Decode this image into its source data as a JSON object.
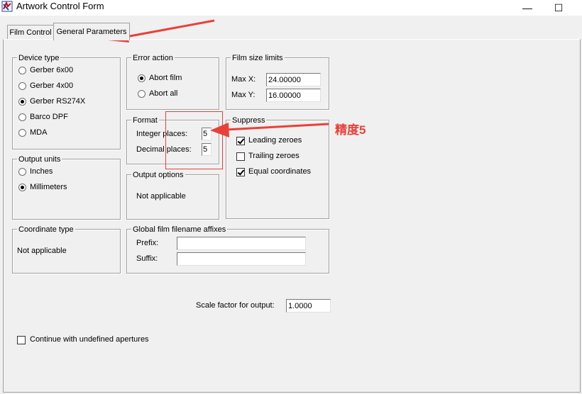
{
  "window": {
    "title": "Artwork Control Form",
    "minimize": "—",
    "maximize": "☐"
  },
  "tabs": [
    {
      "label": "Film Control",
      "active": false
    },
    {
      "label": "General Parameters",
      "active": true
    }
  ],
  "device_type": {
    "label": "Device type",
    "options": [
      {
        "label": "Gerber 6x00",
        "selected": false
      },
      {
        "label": "Gerber 4x00",
        "selected": false
      },
      {
        "label": "Gerber RS274X",
        "selected": true
      },
      {
        "label": "Barco DPF",
        "selected": false
      },
      {
        "label": "MDA",
        "selected": false
      }
    ]
  },
  "error_action": {
    "label": "Error action",
    "options": [
      {
        "label": "Abort film",
        "selected": true
      },
      {
        "label": "Abort all",
        "selected": false
      }
    ]
  },
  "film_size_limits": {
    "label": "Film size limits",
    "max_x_label": "Max X:",
    "max_x": "24.00000",
    "max_y_label": "Max Y:",
    "max_y": "16.00000"
  },
  "format": {
    "label": "Format",
    "integer_label": "Integer places:",
    "integer_value": "5",
    "decimal_label": "Decimal places:",
    "decimal_value": "5"
  },
  "suppress": {
    "label": "Suppress",
    "options": [
      {
        "label": "Leading zeroes",
        "checked": true
      },
      {
        "label": "Trailing zeroes",
        "checked": false
      },
      {
        "label": "Equal coordinates",
        "checked": true
      }
    ]
  },
  "output_units": {
    "label": "Output units",
    "options": [
      {
        "label": "Inches",
        "selected": false
      },
      {
        "label": "Millimeters",
        "selected": true
      }
    ]
  },
  "output_options": {
    "label": "Output options",
    "text": "Not applicable"
  },
  "coordinate_type": {
    "label": "Coordinate type",
    "text": "Not applicable"
  },
  "global_film": {
    "label": "Global film filename affixes",
    "prefix_label": "Prefix:",
    "prefix_value": "",
    "suffix_label": "Suffix:",
    "suffix_value": ""
  },
  "scale": {
    "label": "Scale factor for output:",
    "value": "1.0000"
  },
  "continue_undefined": {
    "label": "Continue with undefined apertures",
    "checked": false
  },
  "annotation": {
    "text": "精度5",
    "color": "#e8413a"
  }
}
